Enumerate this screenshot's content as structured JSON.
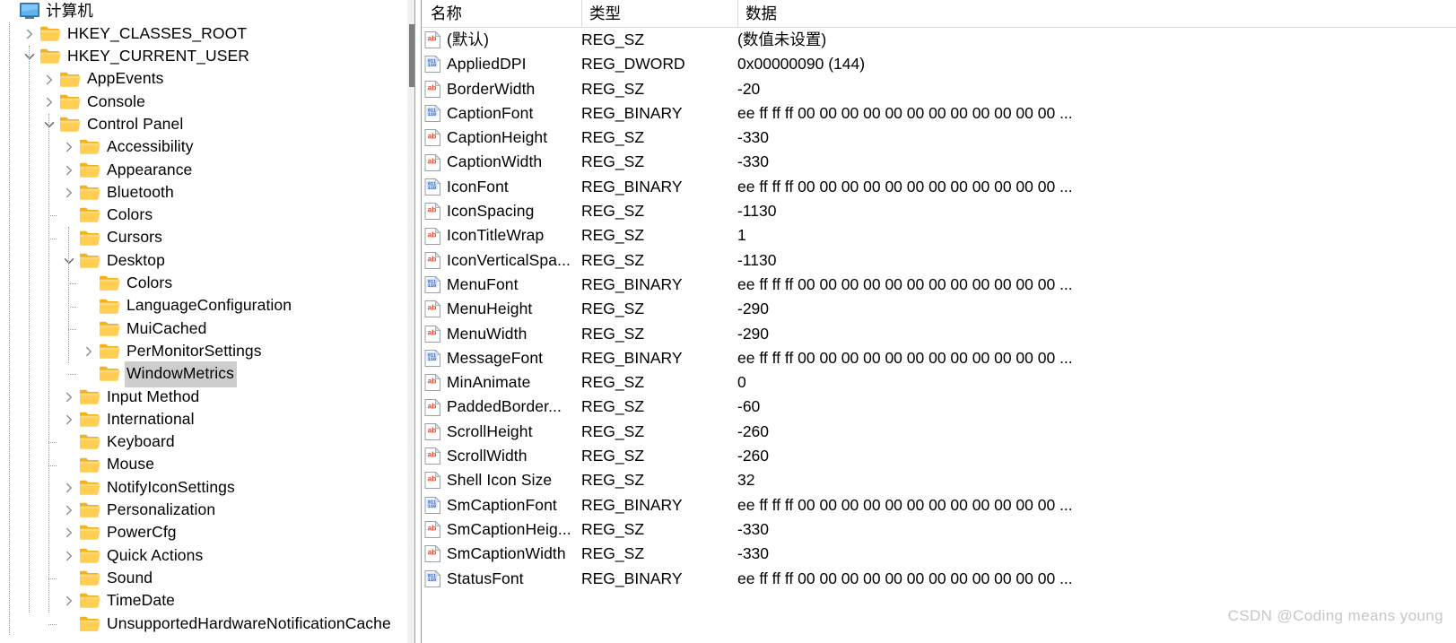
{
  "tree": {
    "root": {
      "label": "计算机",
      "icon": "computer-icon",
      "indent": 0,
      "twisty": "none",
      "selected": false
    },
    "items": [
      {
        "label": "HKEY_CLASSES_ROOT",
        "indent": 1,
        "twisty": "collapsed",
        "selected": false
      },
      {
        "label": "HKEY_CURRENT_USER",
        "indent": 1,
        "twisty": "expanded",
        "selected": false
      },
      {
        "label": "AppEvents",
        "indent": 2,
        "twisty": "collapsed",
        "selected": false
      },
      {
        "label": "Console",
        "indent": 2,
        "twisty": "collapsed",
        "selected": false
      },
      {
        "label": "Control Panel",
        "indent": 2,
        "twisty": "expanded",
        "selected": false
      },
      {
        "label": "Accessibility",
        "indent": 3,
        "twisty": "collapsed",
        "selected": false
      },
      {
        "label": "Appearance",
        "indent": 3,
        "twisty": "collapsed",
        "selected": false
      },
      {
        "label": "Bluetooth",
        "indent": 3,
        "twisty": "collapsed",
        "selected": false
      },
      {
        "label": "Colors",
        "indent": 3,
        "twisty": "none",
        "selected": false
      },
      {
        "label": "Cursors",
        "indent": 3,
        "twisty": "none",
        "selected": false
      },
      {
        "label": "Desktop",
        "indent": 3,
        "twisty": "expanded",
        "selected": false
      },
      {
        "label": "Colors",
        "indent": 4,
        "twisty": "none",
        "selected": false
      },
      {
        "label": "LanguageConfiguration",
        "indent": 4,
        "twisty": "none",
        "selected": false
      },
      {
        "label": "MuiCached",
        "indent": 4,
        "twisty": "none",
        "selected": false
      },
      {
        "label": "PerMonitorSettings",
        "indent": 4,
        "twisty": "collapsed",
        "selected": false
      },
      {
        "label": "WindowMetrics",
        "indent": 4,
        "twisty": "none",
        "selected": true
      },
      {
        "label": "Input Method",
        "indent": 3,
        "twisty": "collapsed",
        "selected": false
      },
      {
        "label": "International",
        "indent": 3,
        "twisty": "collapsed",
        "selected": false
      },
      {
        "label": "Keyboard",
        "indent": 3,
        "twisty": "none",
        "selected": false
      },
      {
        "label": "Mouse",
        "indent": 3,
        "twisty": "none",
        "selected": false
      },
      {
        "label": "NotifyIconSettings",
        "indent": 3,
        "twisty": "collapsed",
        "selected": false
      },
      {
        "label": "Personalization",
        "indent": 3,
        "twisty": "collapsed",
        "selected": false
      },
      {
        "label": "PowerCfg",
        "indent": 3,
        "twisty": "collapsed",
        "selected": false
      },
      {
        "label": "Quick Actions",
        "indent": 3,
        "twisty": "collapsed",
        "selected": false
      },
      {
        "label": "Sound",
        "indent": 3,
        "twisty": "none",
        "selected": false
      },
      {
        "label": "TimeDate",
        "indent": 3,
        "twisty": "collapsed",
        "selected": false
      },
      {
        "label": "UnsupportedHardwareNotificationCache",
        "indent": 3,
        "twisty": "none",
        "selected": false
      }
    ]
  },
  "list": {
    "columns": [
      "名称",
      "类型",
      "数据"
    ],
    "rows": [
      {
        "name": "(默认)",
        "type": "REG_SZ",
        "data": "(数值未设置)",
        "icon": "string-value-icon"
      },
      {
        "name": "AppliedDPI",
        "type": "REG_DWORD",
        "data": "0x00000090 (144)",
        "icon": "binary-value-icon"
      },
      {
        "name": "BorderWidth",
        "type": "REG_SZ",
        "data": "-20",
        "icon": "string-value-icon"
      },
      {
        "name": "CaptionFont",
        "type": "REG_BINARY",
        "data": "ee ff ff ff 00 00 00 00 00 00 00 00 00 00 00 00 ...",
        "icon": "binary-value-icon"
      },
      {
        "name": "CaptionHeight",
        "type": "REG_SZ",
        "data": "-330",
        "icon": "string-value-icon"
      },
      {
        "name": "CaptionWidth",
        "type": "REG_SZ",
        "data": "-330",
        "icon": "string-value-icon"
      },
      {
        "name": "IconFont",
        "type": "REG_BINARY",
        "data": "ee ff ff ff 00 00 00 00 00 00 00 00 00 00 00 00 ...",
        "icon": "binary-value-icon"
      },
      {
        "name": "IconSpacing",
        "type": "REG_SZ",
        "data": "-1130",
        "icon": "string-value-icon"
      },
      {
        "name": "IconTitleWrap",
        "type": "REG_SZ",
        "data": "1",
        "icon": "string-value-icon"
      },
      {
        "name": "IconVerticalSpa...",
        "type": "REG_SZ",
        "data": "-1130",
        "icon": "string-value-icon"
      },
      {
        "name": "MenuFont",
        "type": "REG_BINARY",
        "data": "ee ff ff ff 00 00 00 00 00 00 00 00 00 00 00 00 ...",
        "icon": "binary-value-icon"
      },
      {
        "name": "MenuHeight",
        "type": "REG_SZ",
        "data": "-290",
        "icon": "string-value-icon"
      },
      {
        "name": "MenuWidth",
        "type": "REG_SZ",
        "data": "-290",
        "icon": "string-value-icon"
      },
      {
        "name": "MessageFont",
        "type": "REG_BINARY",
        "data": "ee ff ff ff 00 00 00 00 00 00 00 00 00 00 00 00 ...",
        "icon": "binary-value-icon"
      },
      {
        "name": "MinAnimate",
        "type": "REG_SZ",
        "data": "0",
        "icon": "string-value-icon"
      },
      {
        "name": "PaddedBorder...",
        "type": "REG_SZ",
        "data": "-60",
        "icon": "string-value-icon"
      },
      {
        "name": "ScrollHeight",
        "type": "REG_SZ",
        "data": "-260",
        "icon": "string-value-icon"
      },
      {
        "name": "ScrollWidth",
        "type": "REG_SZ",
        "data": "-260",
        "icon": "string-value-icon"
      },
      {
        "name": "Shell Icon Size",
        "type": "REG_SZ",
        "data": "32",
        "icon": "string-value-icon"
      },
      {
        "name": "SmCaptionFont",
        "type": "REG_BINARY",
        "data": "ee ff ff ff 00 00 00 00 00 00 00 00 00 00 00 00 ...",
        "icon": "binary-value-icon"
      },
      {
        "name": "SmCaptionHeig...",
        "type": "REG_SZ",
        "data": "-330",
        "icon": "string-value-icon"
      },
      {
        "name": "SmCaptionWidth",
        "type": "REG_SZ",
        "data": "-330",
        "icon": "string-value-icon"
      },
      {
        "name": "StatusFont",
        "type": "REG_BINARY",
        "data": "ee ff ff ff 00 00 00 00 00 00 00 00 00 00 00 00 ...",
        "icon": "binary-value-icon"
      }
    ]
  },
  "watermark": "CSDN @Coding means young",
  "colors": {
    "folder_body": "#ffce52",
    "folder_tab": "#fdd97b",
    "selection": "#cdcdcd",
    "scrollbar_thumb": "#7d7d7d",
    "scrollbar_track": "#f0f0f0",
    "string_icon_text": "#e8442d",
    "binary_icon_text": "#2a5fd6",
    "watermark": "#c6c6c6"
  }
}
